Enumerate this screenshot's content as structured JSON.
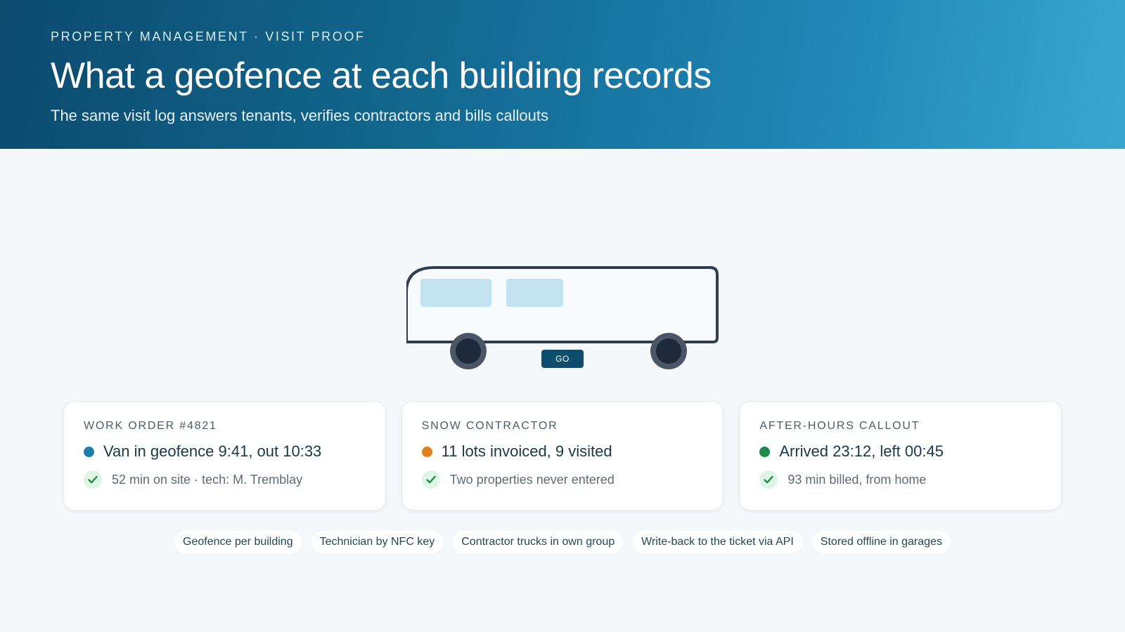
{
  "header": {
    "eyebrow": "PROPERTY MANAGEMENT · VISIT PROOF",
    "title": "What a geofence at each building records",
    "subtitle": "The same visit log answers tenants, verifies contractors and bills callouts"
  },
  "van": {
    "badge": "GO",
    "colors": {
      "body_stroke": "#2f3e4c",
      "window": "#c3e3f1",
      "wheel": "#1e2a3a",
      "wheel_rim": "#4a5666"
    }
  },
  "cards": [
    {
      "kicker": "WORK ORDER #4821",
      "headline": "Van in geofence 9:41, out 10:33",
      "detail": "52 min on site · tech: M. Tremblay",
      "dot_color": "#1a7fae"
    },
    {
      "kicker": "SNOW CONTRACTOR",
      "headline": "11 lots invoiced, 9 visited",
      "detail": "Two properties never entered",
      "dot_color": "#e0801c"
    },
    {
      "kicker": "AFTER-HOURS CALLOUT",
      "headline": "Arrived 23:12, left 00:45",
      "detail": "93 min billed, from home",
      "dot_color": "#1f8a4c"
    }
  ],
  "chips": [
    "Geofence per building",
    "Technician by NFC key",
    "Contractor trucks in own group",
    "Write-back to the ticket via API",
    "Stored offline in garages"
  ],
  "icons": {
    "check": "check-icon",
    "status": "status-dot"
  },
  "colors": {
    "check": "#1f8a4c",
    "check_bg": "#dff5e6"
  }
}
